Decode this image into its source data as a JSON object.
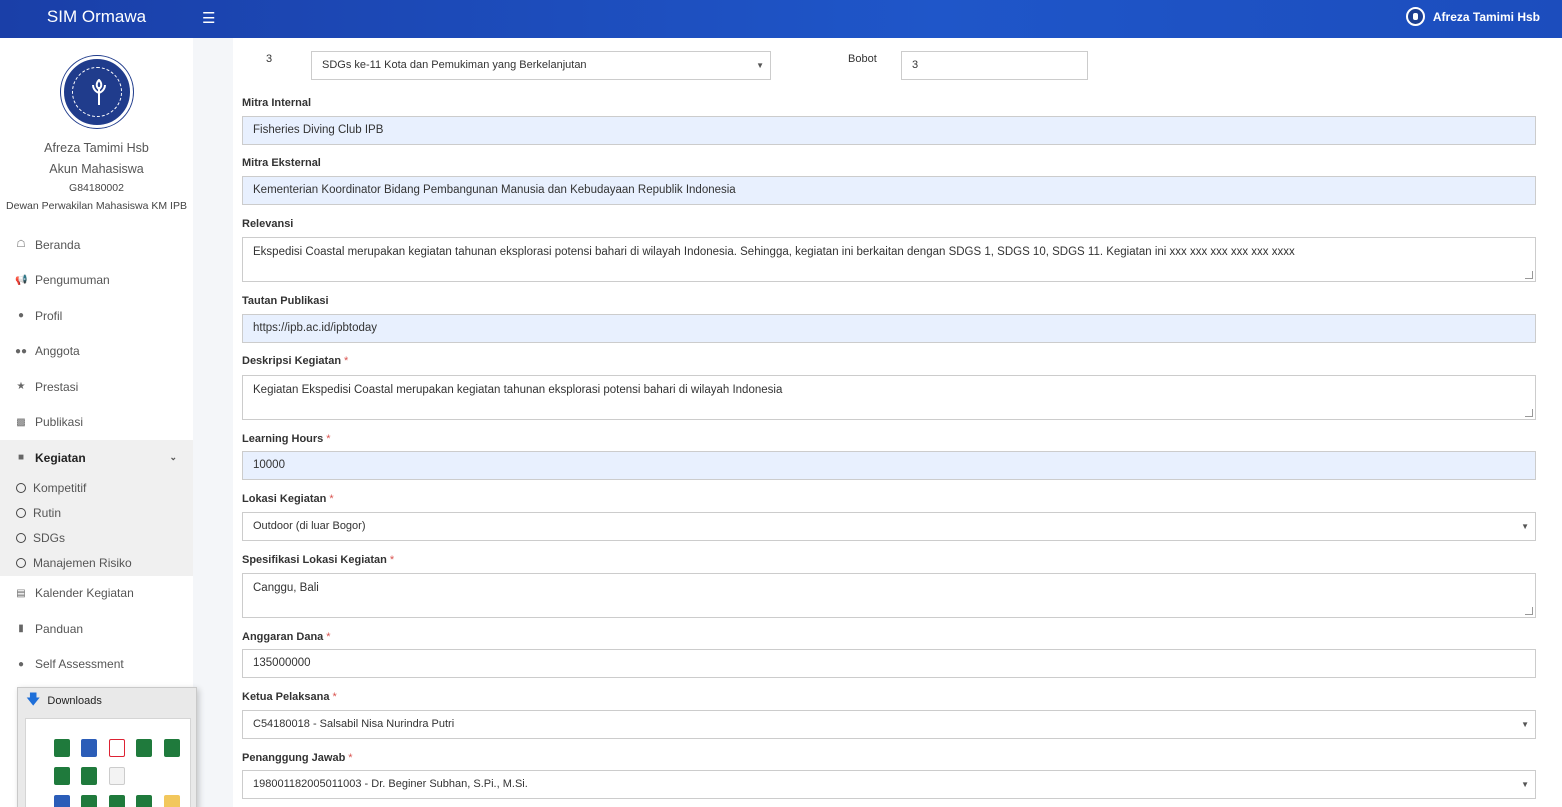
{
  "header": {
    "app_title": "SIM Ormawa",
    "user_name": "Afreza Tamimi Hsb"
  },
  "sidebar": {
    "profile": {
      "name": "Afreza Tamimi Hsb",
      "role": "Akun Mahasiswa",
      "nim": "G84180002",
      "org": "Dewan Perwakilan Mahasiswa KM IPB"
    },
    "menu": [
      {
        "label": "Beranda",
        "icon": "home-icon"
      },
      {
        "label": "Pengumuman",
        "icon": "bullhorn-icon"
      },
      {
        "label": "Profil",
        "icon": "user-icon"
      },
      {
        "label": "Anggota",
        "icon": "users-icon"
      },
      {
        "label": "Prestasi",
        "icon": "trophy-icon"
      },
      {
        "label": "Publikasi",
        "icon": "comments-icon"
      }
    ],
    "active": {
      "label": "Kegiatan",
      "icon": "folder-icon"
    },
    "submenu": [
      "Kompetitif",
      "Rutin",
      "SDGs",
      "Manajemen Risiko"
    ],
    "menu_after": [
      {
        "label": "Kalender Kegiatan",
        "icon": "calendar-icon"
      },
      {
        "label": "Panduan",
        "icon": "book-icon"
      },
      {
        "label": "Self Assessment",
        "icon": "user-icon"
      }
    ]
  },
  "downloads": {
    "title": "Downloads"
  },
  "form": {
    "sdg_row": {
      "number": "3",
      "sdg_value": "SDGs ke-11 Kota dan Pemukiman yang Berkelanjutan",
      "bobot_label": "Bobot",
      "bobot_value": "3"
    },
    "mitra_internal": {
      "label": "Mitra Internal",
      "value": "Fisheries Diving Club IPB"
    },
    "mitra_eksternal": {
      "label": "Mitra Eksternal",
      "value": "Kementerian Koordinator Bidang Pembangunan Manusia dan Kebudayaan Republik Indonesia"
    },
    "relevansi": {
      "label": "Relevansi",
      "value": "Ekspedisi Coastal merupakan kegiatan tahunan eksplorasi potensi bahari di wilayah Indonesia. Sehingga, kegiatan ini berkaitan dengan SDGS 1, SDGS 10, SDGS 11. Kegiatan ini xxx xxx xxx xxx xxx xxxx"
    },
    "tautan": {
      "label": "Tautan Publikasi",
      "value": "https://ipb.ac.id/ipbtoday"
    },
    "deskripsi": {
      "label": "Deskripsi Kegiatan",
      "required": "*",
      "value": "Kegiatan Ekspedisi Coastal merupakan kegiatan tahunan eksplorasi potensi bahari di wilayah Indonesia"
    },
    "learning_hours": {
      "label": "Learning Hours",
      "required": "*",
      "value": "10000"
    },
    "lokasi": {
      "label": "Lokasi Kegiatan",
      "required": "*",
      "value": "Outdoor (di luar Bogor)"
    },
    "spesifikasi": {
      "label": "Spesifikasi Lokasi Kegiatan",
      "required": "*",
      "value": "Canggu, Bali"
    },
    "anggaran": {
      "label": "Anggaran Dana",
      "required": "*",
      "value": "135000000"
    },
    "ketua": {
      "label": "Ketua Pelaksana",
      "required": "*",
      "value": "C54180018 - Salsabil Nisa Nurindra Putri"
    },
    "penanggung": {
      "label": "Penanggung Jawab",
      "required": "*",
      "value": "198001182005011003 - Dr. Beginer Subhan, S.Pi., M.Si."
    }
  },
  "colors": {
    "header_bg": "#1f4fc4",
    "filled_input_bg": "#e8f0fe",
    "required_mark": "#d9534f"
  }
}
